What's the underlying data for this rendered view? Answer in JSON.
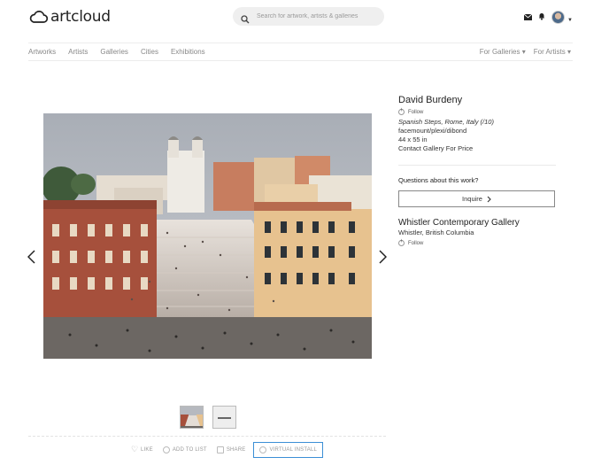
{
  "brand": {
    "name": "artcloud"
  },
  "search": {
    "placeholder": "Search for artwork, artists & galleries"
  },
  "nav": {
    "items": [
      "Artworks",
      "Artists",
      "Galleries",
      "Cities",
      "Exhibitions"
    ],
    "right": [
      "For Galleries ▾",
      "For Artists ▾"
    ]
  },
  "artwork": {
    "artist": "David Burdeny",
    "follow_label": "Follow",
    "title": "Spanish Steps, Rome, Italy (/10)",
    "medium": "facemount/plexi/dibond",
    "size": "44 x 55 in",
    "price": "Contact Gallery For Price"
  },
  "inquiry": {
    "question": "Questions about this work?",
    "button_label": "Inquire"
  },
  "gallery": {
    "name": "Whistler Contemporary Gallery",
    "location": "Whistler, British Columbia",
    "follow_label": "Follow"
  },
  "actions": {
    "like": "LIKE",
    "add_to_list": "ADD TO LIST",
    "share": "SHARE",
    "virtual_install": "VIRTUAL INSTALL"
  },
  "icons": [
    "cloud-logo-icon",
    "search-icon",
    "mail-icon",
    "bell-icon",
    "avatar",
    "chevron-left-icon",
    "chevron-right-icon",
    "chevron-right-small-icon",
    "heart-icon",
    "plus-circle-icon",
    "share-icon",
    "cube-icon"
  ],
  "colors": {
    "accent_outline": "#3b8fd6",
    "text": "#333333",
    "muted": "#888888"
  }
}
